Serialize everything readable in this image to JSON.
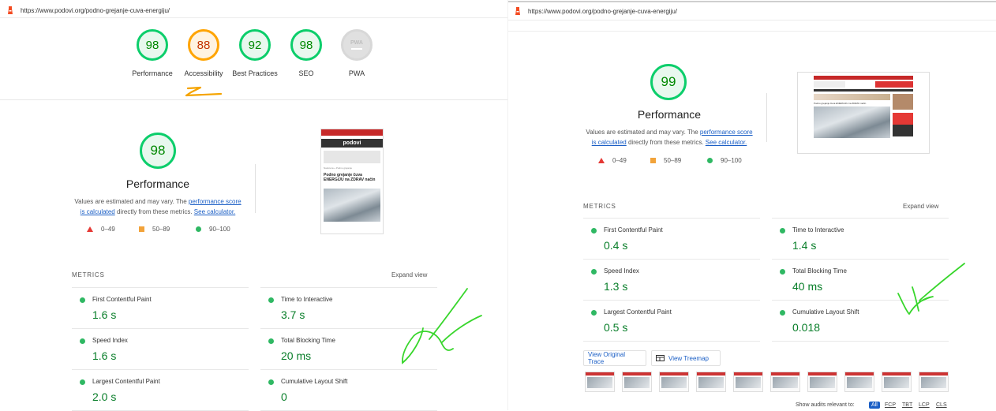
{
  "left": {
    "url": "https://www.podovi.org/podno-grejanje-cuva-energiju/",
    "categories": [
      {
        "score": "98",
        "label": "Performance",
        "status": "pass"
      },
      {
        "score": "88",
        "label": "Accessibility",
        "status": "average"
      },
      {
        "score": "92",
        "label": "Best Practices",
        "status": "pass"
      },
      {
        "score": "98",
        "label": "SEO",
        "status": "pass"
      },
      {
        "score": "PWA",
        "label": "PWA",
        "status": "na"
      }
    ],
    "performance": {
      "score": "98",
      "title": "Performance",
      "desc_pre": "Values are estimated and may vary. The ",
      "desc_link1": "performance score is calculated",
      "desc_mid": " directly from these metrics. ",
      "desc_link2": "See calculator.",
      "legend": [
        "0–49",
        "50–89",
        "90–100"
      ]
    },
    "screenshot": {
      "brand": "podovi",
      "breadcrumb": "Naslovna » Podno grejanje",
      "headline": "Podno grejanje čuva ENERGIJU na ZDRAV način"
    },
    "metrics_heading": "METRICS",
    "expand_view": "Expand view",
    "metrics": [
      {
        "name": "First Contentful Paint",
        "value": "1.6 s"
      },
      {
        "name": "Time to Interactive",
        "value": "3.7 s"
      },
      {
        "name": "Speed Index",
        "value": "1.6 s"
      },
      {
        "name": "Total Blocking Time",
        "value": "20 ms"
      },
      {
        "name": "Largest Contentful Paint",
        "value": "2.0 s"
      },
      {
        "name": "Cumulative Layout Shift",
        "value": "0"
      }
    ]
  },
  "right": {
    "url": "https://www.podovi.org/podno-grejanje-cuva-energiju/",
    "performance": {
      "score": "99",
      "title": "Performance",
      "desc_pre": "Values are estimated and may vary. The ",
      "desc_link1": "performance score is calculated",
      "desc_mid": " directly from these metrics. ",
      "desc_link2": "See calculator.",
      "legend": [
        "0–49",
        "50–89",
        "90–100"
      ]
    },
    "screenshot": {
      "headline": "Podno grejanje čuva ENERGIJU na ZDRAV način"
    },
    "metrics_heading": "METRICS",
    "expand_view": "Expand view",
    "metrics": [
      {
        "name": "First Contentful Paint",
        "value": "0.4 s"
      },
      {
        "name": "Time to Interactive",
        "value": "1.4 s"
      },
      {
        "name": "Speed Index",
        "value": "1.3 s"
      },
      {
        "name": "Total Blocking Time",
        "value": "40 ms"
      },
      {
        "name": "Largest Contentful Paint",
        "value": "0.5 s"
      },
      {
        "name": "Cumulative Layout Shift",
        "value": "0.018"
      }
    ],
    "view_original_trace": "View Original Trace",
    "view_treemap": "View Treemap",
    "audits_label": "Show audits relevant to:",
    "audit_filters": [
      "All",
      "FCP",
      "TBT",
      "LCP",
      "CLS"
    ]
  },
  "colors": {
    "pass": "#0cce6b",
    "average": "#ffa400",
    "fail": "#ff4e42",
    "link": "#1a5ec5",
    "annotation_green": "#38d62c",
    "annotation_orange": "#f5a400"
  }
}
